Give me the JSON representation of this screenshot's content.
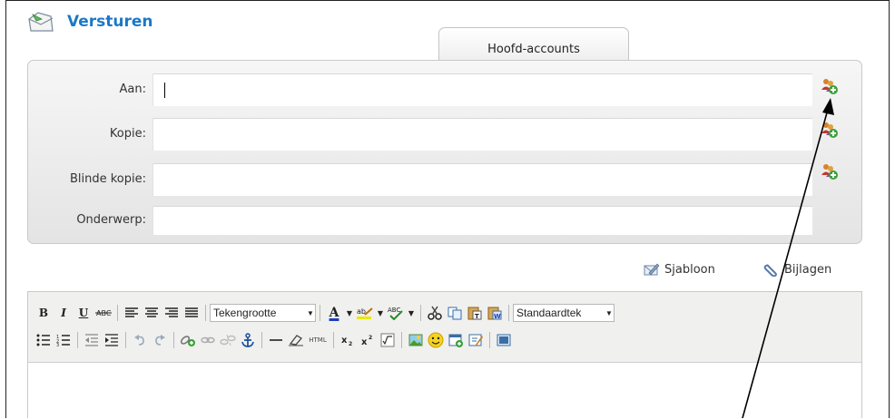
{
  "header": {
    "title": "Versturen",
    "icon": "envelope-send-icon"
  },
  "tabs": [
    {
      "label": "Hoofd-accounts",
      "active": true
    }
  ],
  "form": {
    "to_label": "Aan:",
    "cc_label": "Kopie:",
    "bcc_label": "Blinde kopie:",
    "subject_label": "Onderwerp:",
    "to_value": "",
    "cc_value": "",
    "bcc_value": "",
    "subject_value": ""
  },
  "actions": {
    "template_label": "Sjabloon",
    "attachments_label": "Bijlagen"
  },
  "toolbar": {
    "bold": "B",
    "italic": "I",
    "underline": "U",
    "fontsize_select": "Tekengrootte",
    "text_color": "A",
    "style_select": "Standaardtek",
    "html": "HTML"
  },
  "colors": {
    "title": "#1b78c8",
    "panel": "#ececec",
    "toolbar": "#f0f0ee"
  }
}
